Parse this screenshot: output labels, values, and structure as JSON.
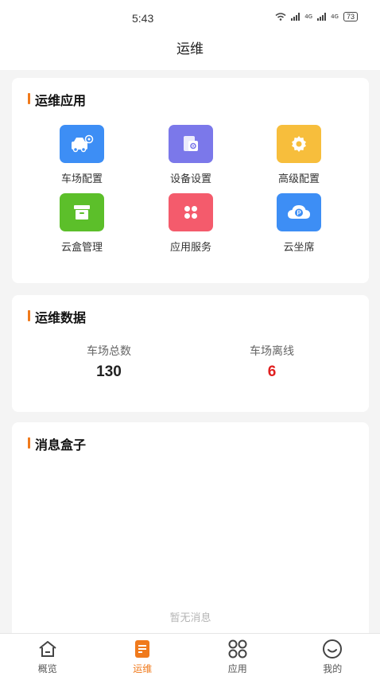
{
  "status_bar": {
    "time": "5:43",
    "network1": "4G",
    "network2": "4G",
    "battery": "73"
  },
  "header": {
    "title": "运维"
  },
  "apps_card": {
    "title": "运维应用",
    "items": [
      {
        "label": "车场配置",
        "icon": "car-icon",
        "color": "#3d8ef5"
      },
      {
        "label": "设备设置",
        "icon": "device-settings-icon",
        "color": "#7b78ea"
      },
      {
        "label": "高级配置",
        "icon": "gear-icon",
        "color": "#f7be3c"
      },
      {
        "label": "云盒管理",
        "icon": "box-icon",
        "color": "#5cbf2a"
      },
      {
        "label": "应用服务",
        "icon": "clover-icon",
        "color": "#f45b6c"
      },
      {
        "label": "云坐席",
        "icon": "cloud-parking-icon",
        "color": "#3d8ef5"
      }
    ]
  },
  "data_card": {
    "title": "运维数据",
    "stats": [
      {
        "label": "车场总数",
        "value": "130"
      },
      {
        "label": "车场离线",
        "value": "6"
      }
    ]
  },
  "message_card": {
    "title": "消息盒子",
    "empty_text": "暂无消息"
  },
  "tabbar": {
    "active_color": "#f07a1c",
    "tabs": [
      {
        "label": "概览",
        "icon": "home-icon"
      },
      {
        "label": "运维",
        "icon": "document-icon"
      },
      {
        "label": "应用",
        "icon": "apps-icon"
      },
      {
        "label": "我的",
        "icon": "smile-icon"
      }
    ]
  }
}
